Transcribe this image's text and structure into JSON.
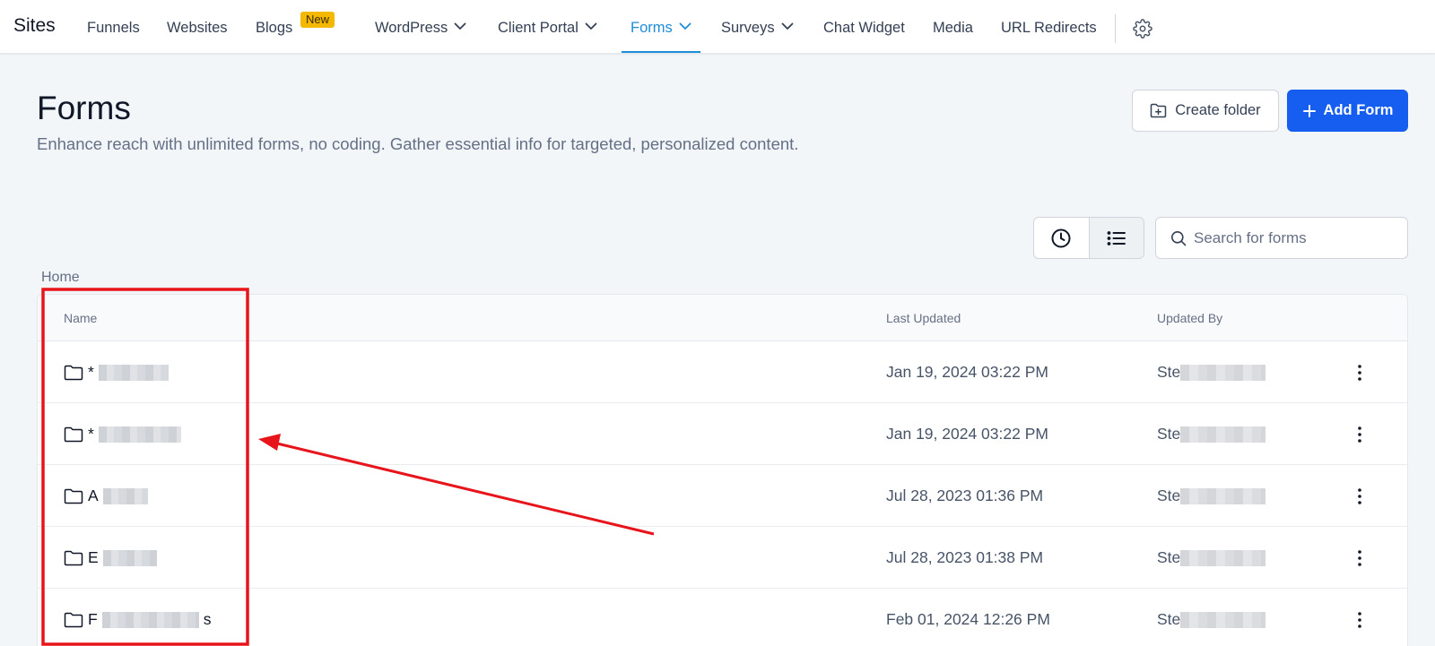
{
  "nav": {
    "brand": "Sites",
    "items": [
      {
        "label": "Funnels"
      },
      {
        "label": "Websites"
      },
      {
        "label": "Blogs"
      },
      {
        "label": "WordPress"
      },
      {
        "label": "Client Portal"
      },
      {
        "label": "Forms"
      },
      {
        "label": "Surveys"
      },
      {
        "label": "Chat Widget"
      },
      {
        "label": "Media"
      },
      {
        "label": "URL Redirects"
      }
    ],
    "active": "Forms",
    "blogs_badge": "New"
  },
  "header": {
    "title": "Forms",
    "description": "Enhance reach with unlimited forms, no coding. Gather essential info for targeted, personalized content.",
    "create_folder_label": "Create folder",
    "add_form_label": "Add Form"
  },
  "search": {
    "placeholder": "Search for forms"
  },
  "breadcrumb": "Home",
  "table": {
    "columns": {
      "name": "Name",
      "last_updated": "Last Updated",
      "updated_by": "Updated By"
    },
    "rows": [
      {
        "name_visible": "*",
        "last_updated": "Jan 19, 2024 03:22 PM",
        "updated_by_visible": "Ste"
      },
      {
        "name_visible": "*",
        "last_updated": "Jan 19, 2024 03:22 PM",
        "updated_by_visible": "Ste"
      },
      {
        "name_visible": "A",
        "last_updated": "Jul 28, 2023 01:36 PM",
        "updated_by_visible": "Ste"
      },
      {
        "name_visible": "E",
        "last_updated": "Jul 28, 2023 01:38 PM",
        "updated_by_visible": "Ste"
      },
      {
        "name_visible": "F",
        "name_suffix": "s",
        "last_updated": "Feb 01, 2024 12:26 PM",
        "updated_by_visible": "Ste"
      }
    ]
  },
  "colors": {
    "accent": "#155eef",
    "nav_active": "#1e8cd6",
    "badge": "#f5b800",
    "annotation": "#e8141b"
  }
}
